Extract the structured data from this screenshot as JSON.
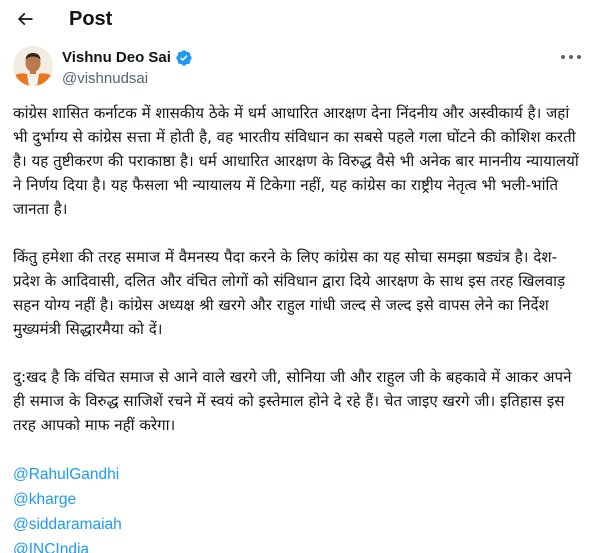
{
  "header": {
    "back_icon": "arrow-left-icon",
    "title": "Post"
  },
  "author": {
    "display_name": "Vishnu Deo Sai",
    "handle": "@vishnudsai",
    "verified_icon": "verified-badge-icon",
    "more_icon": "more-horizontal-icon",
    "verified_color": "#1d9bf0"
  },
  "tweet": {
    "paragraphs": [
      "कांग्रेस शासित कर्नाटक में शासकीय ठेके में धर्म आधारित आरक्षण देना निंदनीय और अस्वीकार्य है। जहां भी दुर्भाग्य से कांग्रेस सत्ता में होती है, वह भारतीय संविधान का सबसे पहले गला घोंटने की कोशिश करती है। यह तुष्टीकरण की पराकाष्ठा है। धर्म आधारित आरक्षण के विरुद्ध वैसे भी अनेक बार माननीय न्यायालयों ने निर्णय दिया है। यह फैसला भी न्यायालय में टिकेगा नहीं, यह कांग्रेस का राष्ट्रीय नेतृत्व भी भली-भांति जानता है।",
      "किंतु हमेशा की तरह समाज में वैमनस्य पैदा करने के लिए कांग्रेस का यह सोचा समझा षड्यंत्र है। देश-प्रदेश के आदिवासी, दलित और वंचित लोगों को संविधान द्वारा दिये आरक्षण के साथ इस तरह खिलवाड़ सहन योग्य नहीं है। कांग्रेस अध्यक्ष श्री खरगे और राहुल गांधी जल्द से जल्द इसे वापस लेने का निर्देश मुख्यमंत्री सिद्धारमैया को दें।",
      "दु:खद है कि वंचित समाज से आने वाले खरगे जी, सोनिया जी और राहुल जी के बहकावे में आकर अपने ही समाज के विरुद्ध साजिशें रचने में स्वयं को इस्तेमाल होने दे रहे हैं। चेत जाइए खरगे जी। इतिहास इस तरह आपको माफ नहीं करेगा।"
    ],
    "mentions": [
      "@RahulGandhi",
      "@kharge",
      "@siddaramaiah",
      "@INCIndia"
    ],
    "link_color": "#1d9bf0"
  }
}
